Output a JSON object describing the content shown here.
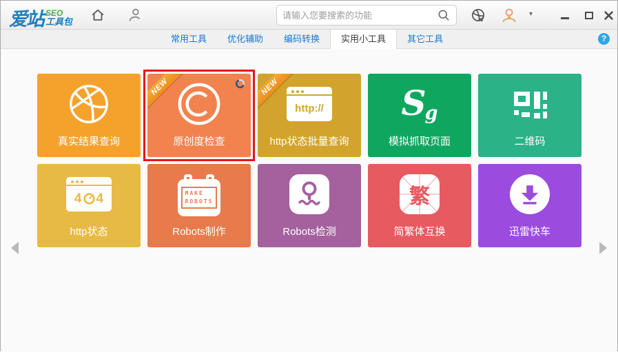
{
  "header": {
    "logo": {
      "brand": "爱站",
      "seo": "SEO",
      "suffix": "工具包"
    },
    "search": {
      "placeholder": "请输入您要搜索的功能"
    }
  },
  "icons": {
    "help": "?",
    "caret": "▾"
  },
  "tabs": [
    {
      "label": "常用工具",
      "active": false
    },
    {
      "label": "优化辅助",
      "active": false
    },
    {
      "label": "编码转换",
      "active": false
    },
    {
      "label": "实用小工具",
      "active": true
    },
    {
      "label": "其它工具",
      "active": false
    }
  ],
  "highlight_color": "#e8131c",
  "tiles": [
    {
      "label": "真实结果查询",
      "color": "#f5a22d"
    },
    {
      "label": "原创度检查",
      "color": "#f2834f",
      "badge": "NEW",
      "highlighted": true,
      "loading": true
    },
    {
      "label": "http状态批量查询",
      "color": "#d2a42c",
      "badge": "NEW",
      "icon_text": "http://"
    },
    {
      "label": "模拟抓取页面",
      "color": "#0fa75f",
      "icon_s": "S",
      "icon_g": "g"
    },
    {
      "label": "二维码",
      "color": "#2cb287"
    },
    {
      "label": "http状态",
      "color": "#e7ba45",
      "icon_left": "4",
      "icon_right": "4"
    },
    {
      "label": "Robots制作",
      "color": "#e87b4c",
      "icon_line1": "MAKE",
      "icon_line2": "ROBOTS"
    },
    {
      "label": "Robots检测",
      "color": "#a5619e"
    },
    {
      "label": "简繁体互换",
      "color": "#e75a60",
      "icon_char": "繁"
    },
    {
      "label": "迅雷快车",
      "color": "#9c4bdf"
    }
  ]
}
